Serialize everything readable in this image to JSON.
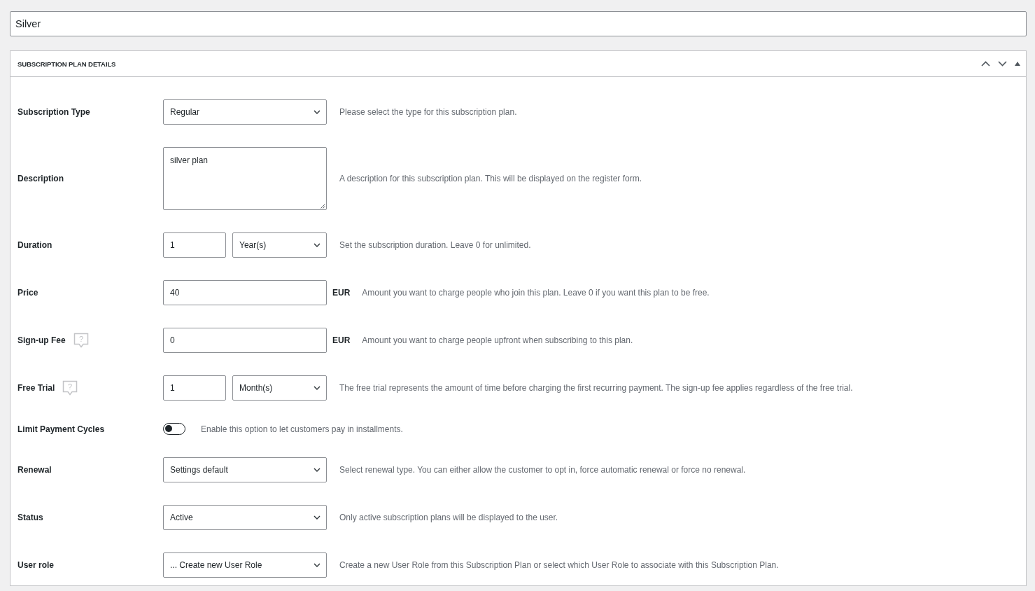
{
  "title_field": {
    "value": "Silver"
  },
  "panel": {
    "title": "SUBSCRIPTION PLAN DETAILS"
  },
  "fields": [
    {
      "kind": "select",
      "label": "Subscription Type",
      "value": "Regular",
      "description": "Please select the type for this subscription plan."
    },
    {
      "kind": "textarea",
      "label": "Description",
      "value": "silver plan",
      "description": "A description for this subscription plan. This will be displayed on the register form."
    },
    {
      "kind": "period",
      "label": "Duration",
      "value": "1",
      "unit": "Year(s)",
      "description": "Set the subscription duration. Leave 0 for unlimited."
    },
    {
      "kind": "money",
      "label": "Price",
      "value": "40",
      "currency": "EUR",
      "description": "Amount you want to charge people who join this plan. Leave 0 if you want this plan to be free."
    },
    {
      "kind": "money",
      "label": "Sign-up Fee",
      "help": "?",
      "value": "0",
      "currency": "EUR",
      "description": "Amount you want to charge people upfront when subscribing to this plan."
    },
    {
      "kind": "period",
      "label": "Free Trial",
      "help": "?",
      "value": "1",
      "unit": "Month(s)",
      "description": "The free trial represents the amount of time before charging the first recurring payment. The sign-up fee applies regardless of the free trial."
    },
    {
      "kind": "toggle",
      "label": "Limit Payment Cycles",
      "on": false,
      "description": "Enable this option to let customers pay in installments."
    },
    {
      "kind": "select",
      "label": "Renewal",
      "value": "Settings default",
      "description": "Select renewal type. You can either allow the customer to opt in, force automatic renewal or force no renewal."
    },
    {
      "kind": "select",
      "label": "Status",
      "value": "Active",
      "description": "Only active subscription plans will be displayed to the user."
    },
    {
      "kind": "select",
      "label": "User role",
      "value": "... Create new User Role",
      "description": "Create a new User Role from this Subscription Plan or select which User Role to associate with this Subscription Plan."
    }
  ]
}
